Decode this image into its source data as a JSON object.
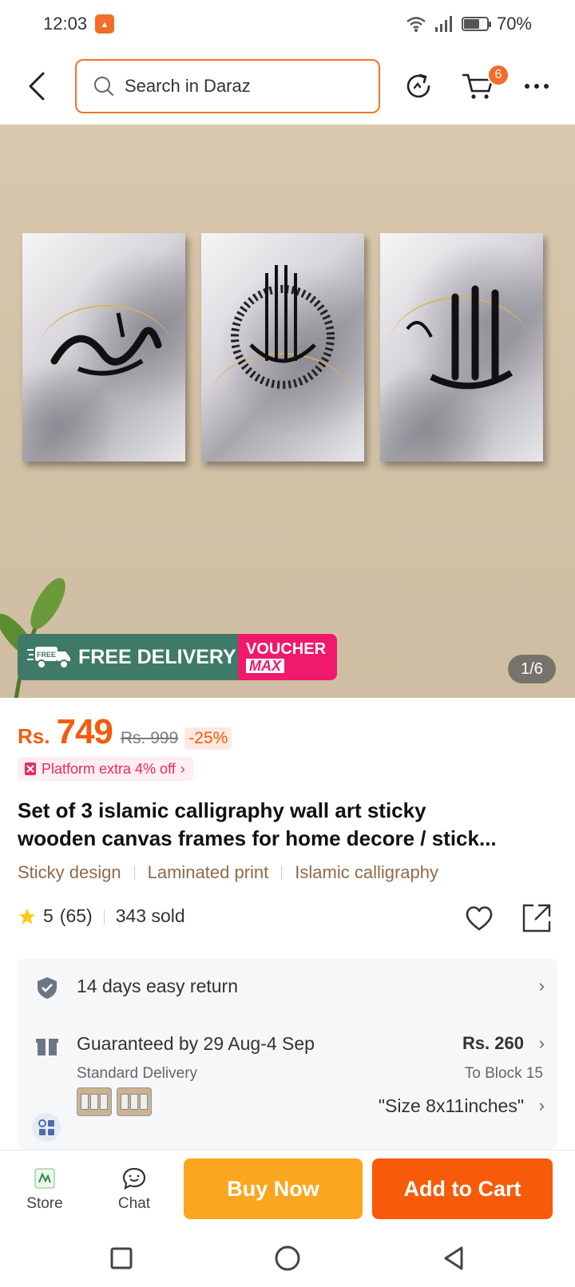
{
  "status": {
    "time": "12:03",
    "battery_pct": "70%",
    "battery_level": 0.7
  },
  "header": {
    "search_placeholder": "Search in Daraz",
    "cart_count": "6"
  },
  "gallery": {
    "pager": "1/6",
    "banner_free": "FREE DELIVERY",
    "banner_free_truck_label": "FREE",
    "banner_voucher_line1": "VOUCHER",
    "banner_voucher_line2": "MAX"
  },
  "price": {
    "currency": "Rs.",
    "current": "749",
    "original": "Rs. 999",
    "discount": "-25%"
  },
  "promo": {
    "platform_extra": "Platform extra 4% off"
  },
  "product": {
    "title_line1": "Set of 3 islamic calligraphy wall art sticky",
    "title_line2": "wooden canvas  frames for home decore / stick...",
    "tags": [
      "Sticky design",
      "Laminated print",
      "Islamic calligraphy"
    ],
    "rating": "5",
    "rating_count": "(65)",
    "sold": "343 sold"
  },
  "info": {
    "return": "14 days easy return",
    "delivery_guarantee": "Guaranteed by 29 Aug-4 Sep",
    "delivery_type": "Standard Delivery",
    "delivery_fee": "Rs. 260",
    "delivery_to": "To Block 15",
    "variant": "\"Size 8x11inches\""
  },
  "bottom": {
    "store": "Store",
    "chat": "Chat",
    "buy_now": "Buy Now",
    "add_to_cart": "Add to Cart"
  },
  "colors": {
    "accent": "#f57224",
    "price": "#f45b0e",
    "buy_now": "#fba61f",
    "add_to_cart": "#f75a08",
    "free_delivery": "#3f7a68",
    "voucher": "#f0196c"
  }
}
